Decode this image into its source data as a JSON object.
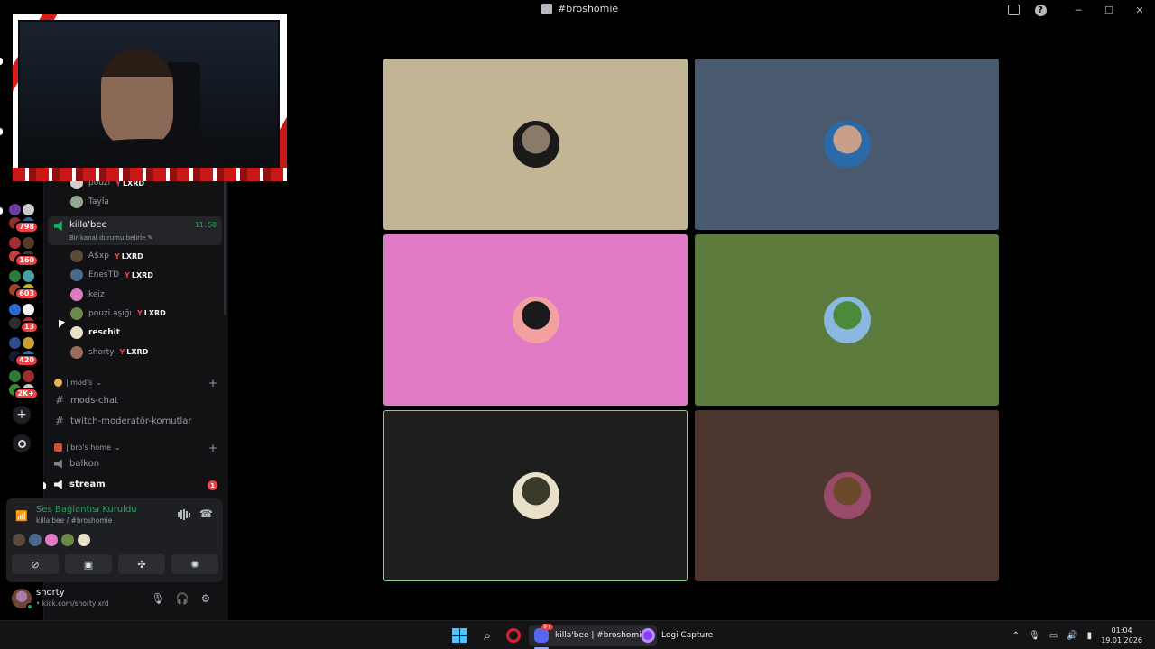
{
  "window": {
    "title": "#broshomie"
  },
  "rail": {
    "servers": [
      {
        "badge": "798",
        "colors": [
          "#6b3fa0",
          "#c9c9c9",
          "#8f2f2f",
          "#2f5f8f"
        ]
      },
      {
        "badge": "160",
        "colors": [
          "#a32d2d",
          "#5a3a2a",
          "#c04040",
          "#3a3a3a"
        ]
      },
      {
        "badge": "603",
        "colors": [
          "#2d7a3a",
          "#4aa0a0",
          "#a0402d",
          "#c9b030"
        ]
      },
      {
        "badge": "13",
        "colors": [
          "#2d6ad0",
          "#f2f3f5",
          "#2d2d2d",
          "#b03030"
        ]
      },
      {
        "badge": "420",
        "colors": [
          "#2d4a8a",
          "#c9a030",
          "#1a1a2a",
          "#3a6aa0"
        ]
      },
      {
        "badge": "2K+",
        "colors": [
          "#2d7a3a",
          "#a02d2d",
          "#3a8a3a",
          "#c9c9c9"
        ]
      }
    ]
  },
  "sidebar": {
    "top_users": [
      {
        "name": "pouzi",
        "tag": "LXRD",
        "color": "#cfcfcf"
      },
      {
        "name": "Tayla",
        "tag": "",
        "color": "#8fa88f"
      }
    ],
    "voice_channel": {
      "name": "killa'bee",
      "status": "Bir kanal durumu belirle",
      "time": "11:50",
      "users": [
        {
          "name": "A$xp",
          "tag": "LXRD",
          "bold": false,
          "color": "#5c4a3a"
        },
        {
          "name": "EnesTD",
          "tag": "LXRD",
          "bold": false,
          "color": "#4a6a8a"
        },
        {
          "name": "keiz",
          "tag": "",
          "bold": false,
          "color": "#e07ac4"
        },
        {
          "name": "pouzi aşığı",
          "tag": "LXRD",
          "bold": false,
          "color": "#6a8a4a"
        },
        {
          "name": "reschit",
          "tag": "",
          "bold": true,
          "color": "#e8e0c8"
        },
        {
          "name": "shorty",
          "tag": "LXRD",
          "bold": false,
          "color": "#9a6a5a"
        }
      ]
    },
    "categories": [
      {
        "name": "| mod's",
        "channels": [
          {
            "name": "mods-chat",
            "type": "text",
            "bold": false
          },
          {
            "name": "twitch-moderatör-komutlar",
            "type": "text",
            "bold": false
          }
        ]
      },
      {
        "name": "| bro's home",
        "channels": [
          {
            "name": "balkon",
            "type": "voice",
            "bold": false
          },
          {
            "name": "stream",
            "type": "voice",
            "bold": true,
            "badge": "1"
          }
        ]
      }
    ]
  },
  "voice_panel": {
    "status": "Ses Bağlantısı Kuruldu",
    "location": "killa'bee / #broshomie",
    "mini_avatars": [
      "#5c4a3a",
      "#4a6a8a",
      "#e07ac4",
      "#6a8a4a",
      "#e8e0c8"
    ]
  },
  "user_panel": {
    "name": "shorty",
    "status": "• kick.com/shortylxrd"
  },
  "tiles": [
    {
      "bg": "#c2b593",
      "avatar": [
        "#1a1a1a",
        "#8a7a6a"
      ],
      "active": false
    },
    {
      "bg": "#4a5a6e",
      "avatar": [
        "#2a6aa8",
        "#c8a08a"
      ],
      "active": false
    },
    {
      "bg": "#e07ac4",
      "avatar": [
        "#f2a0a0",
        "#1a1a1a"
      ],
      "active": false
    },
    {
      "bg": "#5b7a3c",
      "avatar": [
        "#8ab8e0",
        "#4a8a3a"
      ],
      "active": false
    },
    {
      "bg": "#1e1f1c",
      "avatar": [
        "#e8e0c8",
        "#3a3a2a"
      ],
      "active": true
    },
    {
      "bg": "#4e3630",
      "avatar": [
        "#9a4a6a",
        "#6a4a2a"
      ],
      "active": false
    }
  ],
  "taskbar": {
    "apps": [
      {
        "label": "killa'bee | #broshomie -",
        "icon": "discord-icon",
        "active": true,
        "badge": "9+"
      },
      {
        "label": "Logi Capture",
        "icon": "logi-capture-icon",
        "active": false
      }
    ],
    "clock_time": "01:04",
    "clock_date": "19.01.2026"
  }
}
